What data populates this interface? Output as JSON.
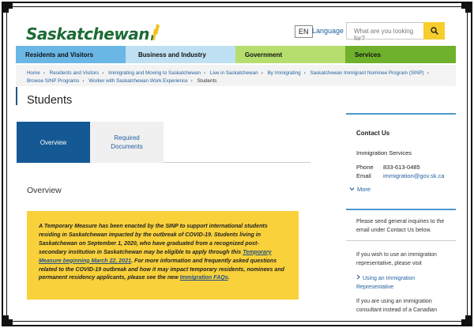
{
  "header": {
    "logo_text": "Saskatchewan",
    "lang_badge": "EN",
    "lang_link": "Language",
    "search_placeholder": "What are you looking for?"
  },
  "nav": [
    "Residents and Visitors",
    "Business and Industry",
    "Government",
    "Services"
  ],
  "breadcrumb": [
    "Home",
    "Residents and Visitors",
    "Immigrating and Moving to Saskatchewan",
    "Live in Saskatchewan",
    "By Immigrating",
    "Saskatchewan Immigrant Nominee Program (SINP)",
    "Browse SINP Programs",
    "Worker with Saskatchewan Work Experience",
    "Students"
  ],
  "page_title": "Students",
  "tabs": [
    {
      "label": "Overview",
      "active": true
    },
    {
      "label": "Required Documents",
      "active": false
    }
  ],
  "section_title": "Overview",
  "notice": {
    "text_1": "A Temporary Measure has been enacted by the SINP to support international students residing in Saskatchewan impacted by the outbreak of COVID-19. Students living in Saskatchewan on September 1, 2020, who have graduated from a recognized post-secondary institution in Saskatchewan may be eligible to apply through this ",
    "link_1": "Temporary Measure beginning March 22, 2021",
    "text_2": ". For more information and frequently asked questions related to the COVID-19 outbreak and how it may impact temporary residents, nominees and permanent residency applicants, please see the new ",
    "link_2": "Immigration FAQs",
    "text_3": "."
  },
  "sidebar": {
    "heading": "Contact Us",
    "subheading": "Immigration Services",
    "phone_label": "Phone",
    "phone_value": "833-613-0485",
    "email_label": "Email",
    "email_value": "immigration@gov.sk.ca",
    "more": "More",
    "inquiries": "Please send general inquiries to the email under Contact Us below.",
    "rep_text": "If you wish to use an immigration representative, please visit",
    "rep_link": "Using an Immigration Representative",
    "consultant_text": "If you are using an immigration consultant instead of a Canadian"
  },
  "colors": {
    "nav_residents": "#6ab7e6",
    "nav_business": "#bfe0f2",
    "nav_government": "#b6de6e",
    "nav_services": "#6fb12c",
    "tab_active": "#155994",
    "notice_bg": "#f9d13b",
    "search_button": "#f6cd2c",
    "logo_green": "#1c6b35"
  },
  "icons": [
    "wheat-logo-icon",
    "search-icon",
    "chevron-down-icon",
    "chevron-right-icon"
  ]
}
